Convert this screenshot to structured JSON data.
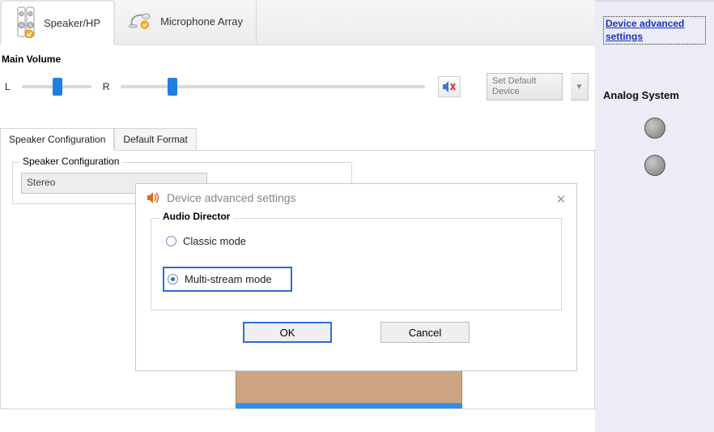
{
  "tabs": {
    "speaker": "Speaker/HP",
    "mic": "Microphone Array"
  },
  "volume": {
    "label": "Main Volume",
    "L": "L",
    "R": "R"
  },
  "set_default": {
    "label": "Set Default Device"
  },
  "sub_tabs": {
    "config": "Speaker Configuration",
    "format": "Default Format"
  },
  "fieldset": {
    "legend": "Speaker Configuration",
    "value": "Stereo"
  },
  "dialog": {
    "title": "Device advanced settings",
    "group": "Audio Director",
    "classic": "Classic mode",
    "multi": "Multi-stream mode",
    "ok": "OK",
    "cancel": "Cancel"
  },
  "side": {
    "link": "Device advanced settings",
    "title": "Analog System"
  }
}
